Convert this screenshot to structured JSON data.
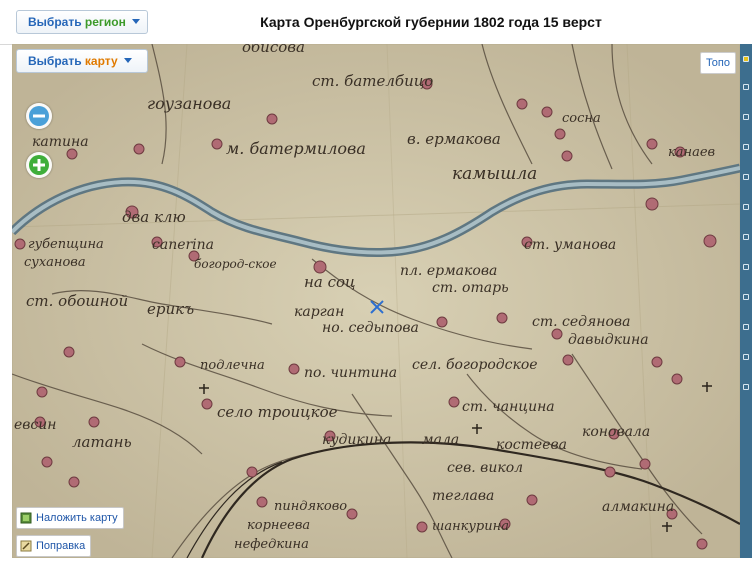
{
  "header": {
    "region_button": {
      "prefix": "Выбрать ",
      "highlight": "регион",
      "highlight_color": "#3c9a2a"
    },
    "map_button": {
      "prefix": "Выбрать ",
      "highlight": "карту",
      "highlight_color": "#e07a00"
    },
    "title": "Карта Оренбургской губернии 1802 года 15 верст"
  },
  "map_controls": {
    "topo_label": "Топо",
    "overlay_label": "Наложить карту",
    "correction_label": "Поправка",
    "zoom_out_icon": "minus-icon",
    "zoom_in_icon": "plus-icon"
  },
  "map_labels": [
    "обисова",
    "ст. бателбицо",
    "гоузанова",
    "катина",
    "м. батермиловa",
    "в. ермакова",
    "сосна",
    "канаев",
    "камышла",
    "два клю",
    "губеnщина",
    "сапеrina",
    "суханова",
    "богород-ское",
    "ст. уманова",
    "на соц",
    "пл. ермакова",
    "ст. отарь",
    "карган",
    "но. седыпова",
    "ст. седянова",
    "давыдкина",
    "ст. обошной",
    "ерикъ",
    "подлечна",
    "по. чинтина",
    "сел. богородское",
    "село троицкое",
    "ст. чанцина",
    "коновала",
    "евсин",
    "латань",
    "кудикина",
    "мала",
    "костеева",
    "сев. викол",
    "пиндяково",
    "корнеева",
    "теглава",
    "алмакина",
    "шанкурина",
    "нефедкина"
  ],
  "colors": {
    "parchment": "#cfc6a9",
    "river": "#7f97a2",
    "settlement": "#b06b74",
    "ink": "#3a3026",
    "accent": "#2566b8"
  }
}
